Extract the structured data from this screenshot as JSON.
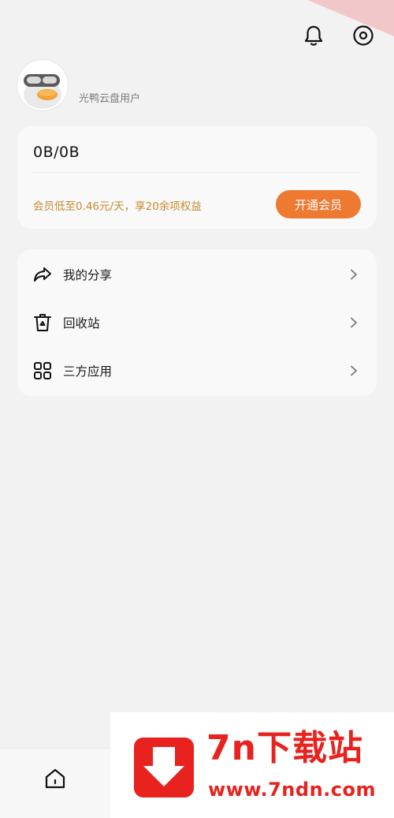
{
  "header": {
    "notification_icon": "bell-icon",
    "settings_icon": "settings-eye-icon"
  },
  "profile": {
    "avatar_icon": "duck-mascot-avatar",
    "username": "光鸭云盘用户"
  },
  "storage_card": {
    "usage": "0B/0B",
    "promo": "会员低至0.46元/天，享20余项权益",
    "vip_button": "开通会员",
    "accent_color": "#ee7a32",
    "promo_color": "#c58a2a"
  },
  "menu": {
    "items": [
      {
        "label": "我的分享",
        "icon": "share-arrow-icon"
      },
      {
        "label": "回收站",
        "icon": "recycle-bin-icon"
      },
      {
        "label": "三方应用",
        "icon": "apps-grid-icon"
      }
    ]
  },
  "bottom_nav": {
    "home_icon": "home-icon"
  },
  "watermark": {
    "title": "7n下载站",
    "url": "www.7ndn.com",
    "color": "#e8221e"
  }
}
